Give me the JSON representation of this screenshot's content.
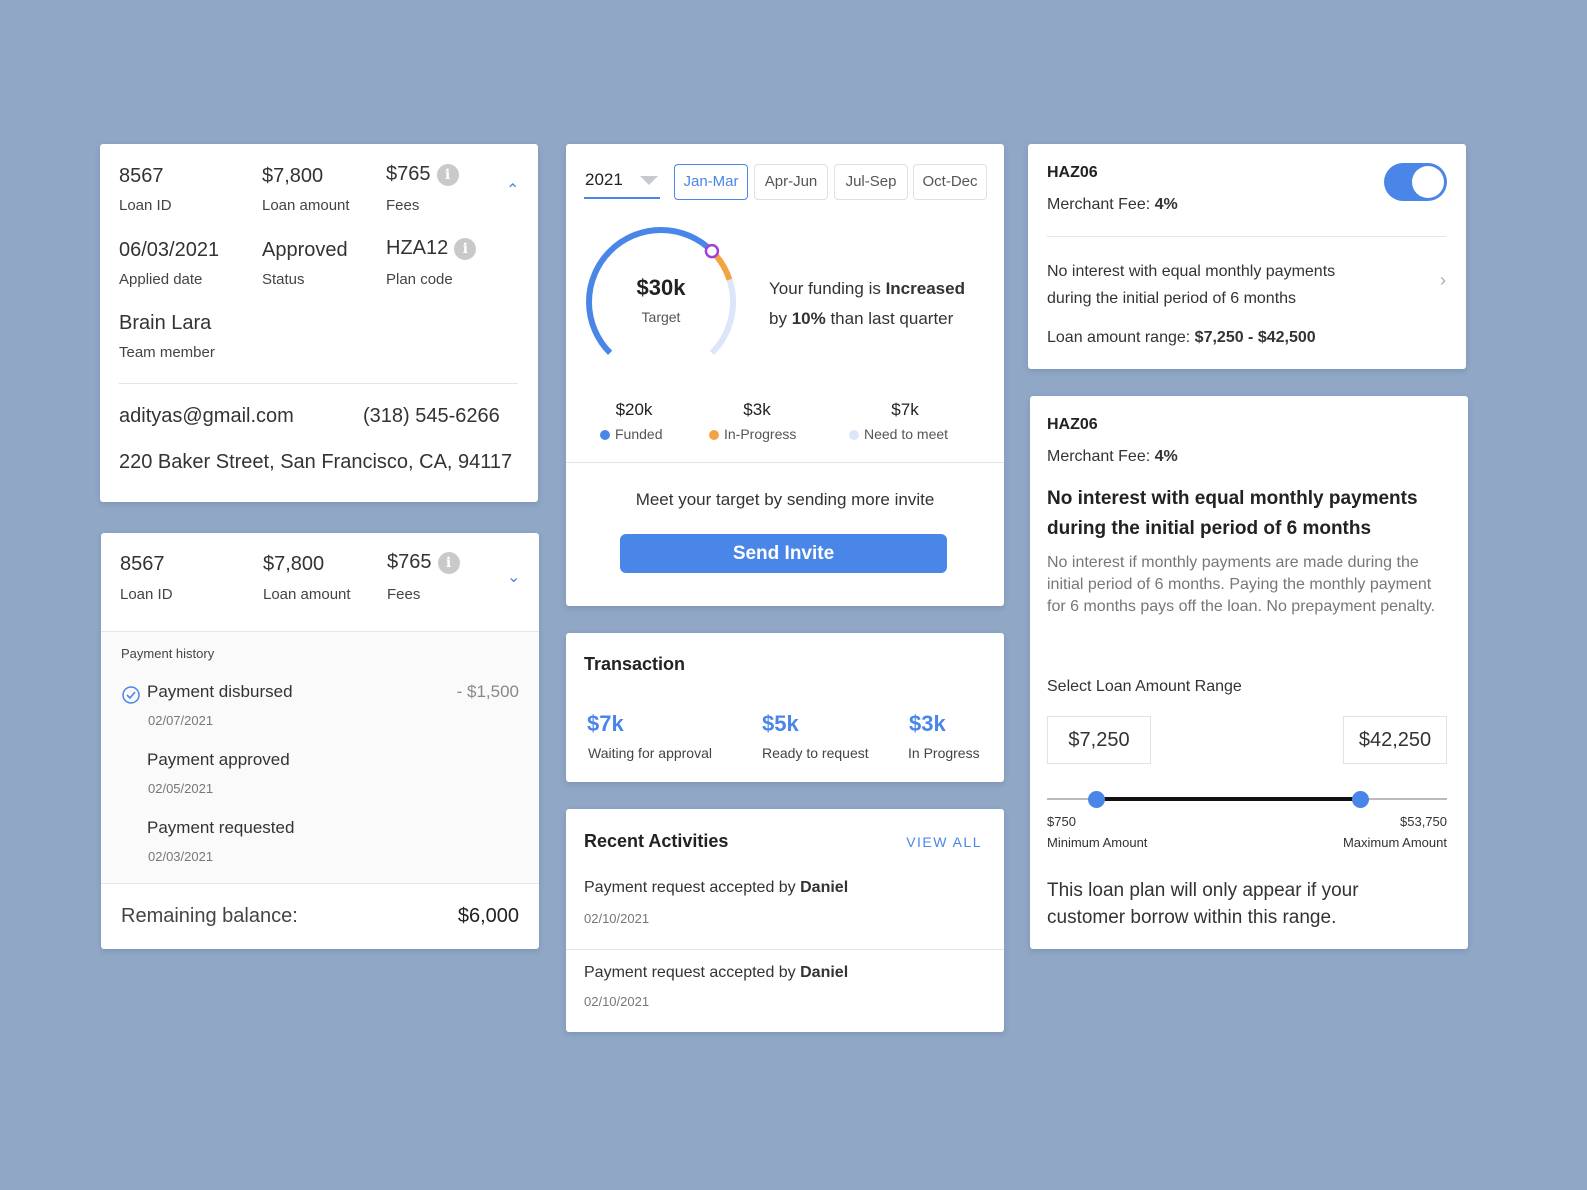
{
  "loan_card_expanded": {
    "loan_id": "8567",
    "loan_id_label": "Loan ID",
    "loan_amount": "$7,800",
    "loan_amount_label": "Loan amount",
    "fees": "$765",
    "fees_label": "Fees",
    "applied_date": "06/03/2021",
    "applied_date_label": "Applied date",
    "status": "Approved",
    "status_label": "Status",
    "plan_code": "HZA12",
    "plan_code_label": "Plan code",
    "team_member": "Brain Lara",
    "team_member_label": "Team member",
    "email": "adityas@gmail.com",
    "phone": "(318) 545-6266",
    "address": "220 Baker Street, San Francisco, CA, 94117"
  },
  "loan_card_history": {
    "loan_id": "8567",
    "loan_id_label": "Loan ID",
    "loan_amount": "$7,800",
    "loan_amount_label": "Loan amount",
    "fees": "$765",
    "fees_label": "Fees",
    "history_title": "Payment history",
    "history": [
      {
        "title": "Payment disbursed",
        "date": "02/07/2021",
        "amount": "- $1,500",
        "checked": true
      },
      {
        "title": "Payment approved",
        "date": "02/05/2021"
      },
      {
        "title": "Payment requested",
        "date": "02/03/2021"
      }
    ],
    "remaining_label": "Remaining balance:",
    "remaining_value": "$6,000"
  },
  "funding": {
    "year": "2021",
    "quarters": [
      "Jan-Mar",
      "Apr-Jun",
      "Jul-Sep",
      "Oct-Dec"
    ],
    "active_quarter": "Jan-Mar",
    "target_value": "$30k",
    "target_label": "Target",
    "msg_pre": "Your funding is ",
    "msg_bold1": "Increased",
    "msg_mid": "by ",
    "msg_bold2": "10%",
    "msg_post": " than last quarter",
    "gauge": {
      "target": 30,
      "funded": 20,
      "in_progress": 3,
      "need": 7
    },
    "legend": [
      {
        "value": "$20k",
        "label": "Funded",
        "color": "#4a86e8"
      },
      {
        "value": "$3k",
        "label": "In-Progress",
        "color": "#f2a444"
      },
      {
        "value": "$7k",
        "label": "Need to meet",
        "color": "#dbe6fa"
      }
    ],
    "invite_text": "Meet your target by sending more invite",
    "invite_button": "Send Invite",
    "accent": "#4a86e8"
  },
  "transaction": {
    "title": "Transaction",
    "items": [
      {
        "value": "$7k",
        "label": "Waiting for approval"
      },
      {
        "value": "$5k",
        "label": "Ready to request"
      },
      {
        "value": "$3k",
        "label": "In Progress"
      }
    ]
  },
  "activities": {
    "title": "Recent Activities",
    "view_all": "VIEW ALL",
    "items": [
      {
        "text": "Payment request accepted by ",
        "name": "Daniel",
        "date": "02/10/2021"
      },
      {
        "text": "Payment request accepted by ",
        "name": "Daniel",
        "date": "02/10/2021"
      }
    ]
  },
  "plan_small": {
    "code": "HAZ06",
    "fee_label": "Merchant Fee: ",
    "fee": "4%",
    "toggle_on": true,
    "desc1": "No interest with equal monthly payments",
    "desc2": "during the initial period of 6 months",
    "range_label": "Loan amount range: ",
    "range": "$7,250 - $42,500"
  },
  "plan_detail": {
    "code": "HAZ06",
    "fee_label": "Merchant Fee: ",
    "fee": "4%",
    "headline1": "No interest with equal monthly payments",
    "headline2": "during the initial period of 6 months",
    "body": "No interest if monthly payments are made during the initial period of 6 months. Paying the monthly payment for 6 months pays off the loan. No prepayment penalty.",
    "select_label": "Select Loan Amount Range",
    "min_input": "$7,250",
    "max_input": "$42,250",
    "slider": {
      "min": 750,
      "max": 53750,
      "low": 7250,
      "high": 42250
    },
    "min_value": "$750",
    "min_label": "Minimum Amount",
    "max_value": "$53,750",
    "max_label": "Maximum Amount",
    "footer1": "This loan plan will only appear if your",
    "footer2": "customer borrow within this range."
  }
}
